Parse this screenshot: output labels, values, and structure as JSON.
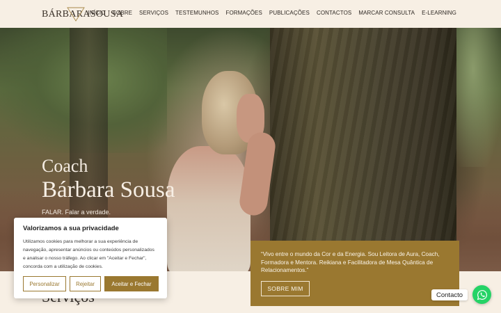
{
  "header": {
    "logo_text": "BÁRBARASOUSA",
    "nav": [
      "INÍCIO",
      "SOBRE",
      "SERVIÇOS",
      "TESTEMUNHOS",
      "FORMAÇÕES",
      "PUBLICAÇÕES",
      "CONTACTOS",
      "MARCAR CONSULTA",
      "E-LEARNING"
    ]
  },
  "hero": {
    "subtitle": "Coach",
    "title": "Bárbara Sousa",
    "tagline": "FALAR. Falar a verdade."
  },
  "quote": {
    "text": "“Vivo entre o mundo da Cor e da Energia. Sou Leitora de Aura, Coach, Formadora e Mentora. Reikiana e Facilitadora de Mesa Quântica de Relacionamentos.”",
    "button": "SOBRE MIM"
  },
  "section": {
    "title": "Serviços"
  },
  "cookie": {
    "title": "Valorizamos a sua privacidade",
    "body": "Utilizamos cookies para melhorar a sua experiência de navegação, apresentar anúncios ou conteúdos personalizados e analisar o nosso tráfego. Ao clicar em \"Aceitar e Fechar\", concorda com a utilização de cookies.",
    "customize": "Personalizar",
    "reject": "Rejeitar",
    "accept": "Aceitar e Fechar"
  },
  "whatsapp": {
    "label": "Contacto",
    "icon": "whatsapp-icon",
    "color": "#25d366"
  },
  "colors": {
    "accent": "#9a7830",
    "background": "#f7efe4"
  }
}
